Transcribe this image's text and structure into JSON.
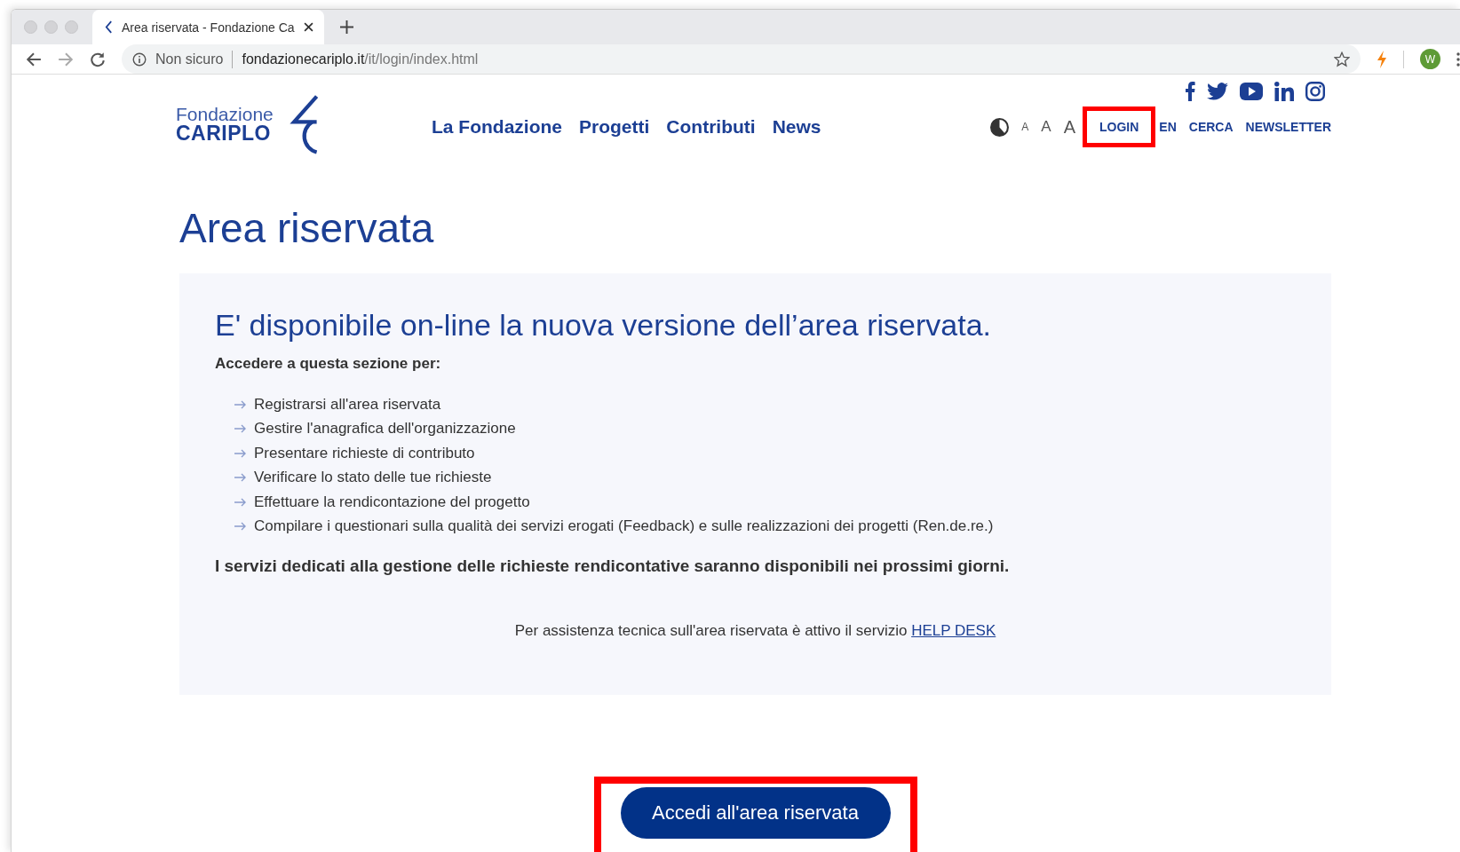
{
  "browser": {
    "tab_title": "Area riservata - Fondazione Ca",
    "security": "Non sicuro",
    "url_domain": "fondazionecariplo.it",
    "url_path": "/it/login/index.html",
    "profile": "W"
  },
  "header": {
    "logo": {
      "line1": "Fondazione",
      "line2": "CARIPLO"
    },
    "nav": [
      "La Fondazione",
      "Progetti",
      "Contributi",
      "News"
    ],
    "text_sizes": [
      "A",
      "A",
      "A"
    ],
    "links": [
      {
        "label": "LOGIN",
        "highlighted": true
      },
      {
        "label": "EN",
        "highlighted": false
      },
      {
        "label": "CERCA",
        "highlighted": false
      },
      {
        "label": "NEWSLETTER",
        "highlighted": false
      }
    ]
  },
  "page_title": "Area riservata",
  "notice": {
    "heading": "E' disponibile on-line la nuova versione dell’area riservata.",
    "intro": "Accedere a questa sezione per:",
    "items": [
      "Registrarsi all'area riservata",
      "Gestire l'anagrafica dell'organizzazione",
      "Presentare richieste di contributo",
      "Verificare lo stato delle tue richieste",
      "Effettuare la rendicontazione del progetto",
      "Compilare i questionari sulla qualità dei servizi erogati (Feedback) e sulle realizzazioni dei progetti (Ren.de.re.)"
    ],
    "note": "I servizi dedicati alla gestione delle richieste rendicontative saranno disponibili nei prossimi giorni.",
    "help_text": "Per assistenza tecnica sull'area riservata è attivo il servizio",
    "help_link": "HELP DESK"
  },
  "main_button": {
    "label": "Accedi all'area riservata",
    "highlighted": true
  }
}
